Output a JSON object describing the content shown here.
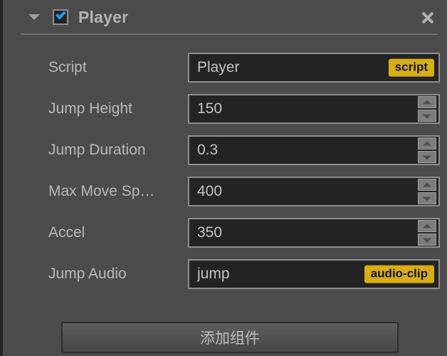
{
  "panel": {
    "title": "Player",
    "collapse_icon": "triangle-down-icon",
    "enabled": true,
    "close_icon": "close-icon"
  },
  "properties": [
    {
      "label": "Script",
      "type": "asset",
      "value": "Player",
      "badge": "script"
    },
    {
      "label": "Jump Height",
      "type": "number",
      "value": "150"
    },
    {
      "label": "Jump Duration",
      "type": "number",
      "value": "0.3"
    },
    {
      "label": "Max Move Sp…",
      "type": "number",
      "value": "400"
    },
    {
      "label": "Accel",
      "type": "number",
      "value": "350"
    },
    {
      "label": "Jump Audio",
      "type": "asset",
      "value": "jump",
      "badge": "audio-clip"
    }
  ],
  "footer": {
    "add_component_label": "添加组件"
  },
  "colors": {
    "panel_background": "#4b4b4b",
    "field_background": "#232323",
    "field_border": "#8d8d8d",
    "label_text": "#b9b9b9",
    "badge_background": "#d8ae16",
    "badge_text": "#141414",
    "checkbox_accent": "#1b9af7"
  }
}
